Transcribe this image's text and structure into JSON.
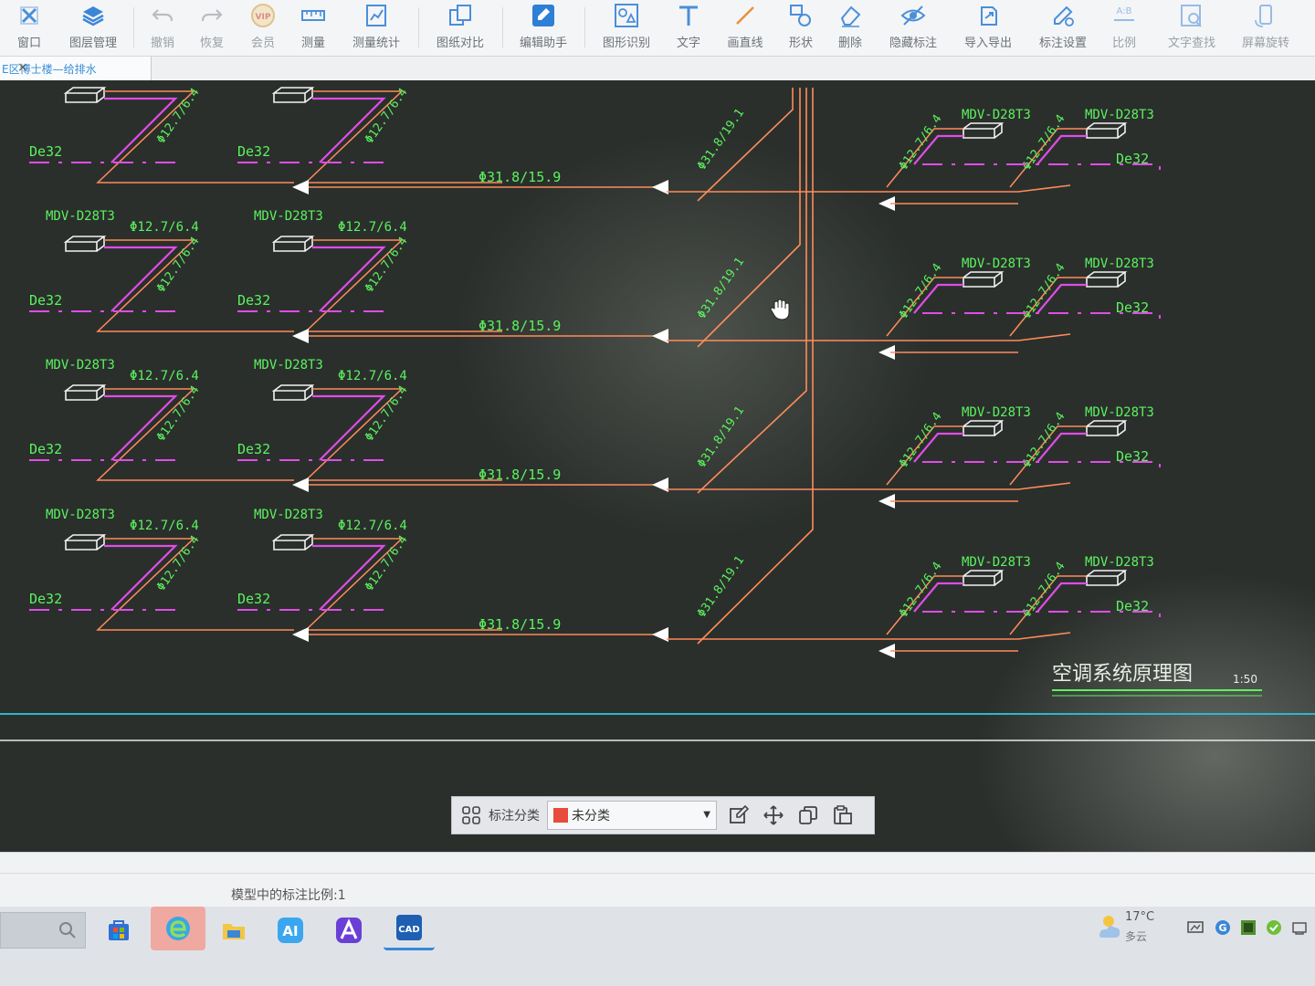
{
  "toolbar": {
    "items": [
      {
        "label": "窗口",
        "icon": "window-icon"
      },
      {
        "label": "图层管理",
        "icon": "layers-icon"
      },
      {
        "label": "撤销",
        "icon": "undo-icon"
      },
      {
        "label": "恢复",
        "icon": "redo-icon"
      },
      {
        "label": "会员",
        "icon": "vip-icon"
      },
      {
        "label": "测量",
        "icon": "ruler-icon"
      },
      {
        "label": "测量统计",
        "icon": "measure-stats-icon"
      },
      {
        "label": "图纸对比",
        "icon": "compare-icon"
      },
      {
        "label": "编辑助手",
        "icon": "edit-assistant-icon"
      },
      {
        "label": "图形识别",
        "icon": "shape-recognition-icon"
      },
      {
        "label": "文字",
        "icon": "text-icon"
      },
      {
        "label": "画直线",
        "icon": "line-icon"
      },
      {
        "label": "形状",
        "icon": "shape-icon"
      },
      {
        "label": "删除",
        "icon": "eraser-icon"
      },
      {
        "label": "隐藏标注",
        "icon": "hide-annotation-icon"
      },
      {
        "label": "导入导出",
        "icon": "import-export-icon"
      },
      {
        "label": "标注设置",
        "icon": "annotation-settings-icon"
      },
      {
        "label": "比例",
        "icon": "scale-icon"
      },
      {
        "label": "文字查找",
        "icon": "text-search-icon"
      },
      {
        "label": "屏幕旋转",
        "icon": "screen-rotate-icon"
      }
    ]
  },
  "tab": {
    "title": "E区博士楼—给排水",
    "close": "×"
  },
  "drawing": {
    "title": "空调系统原理图",
    "scale": "1:50",
    "unit_label": "MDV-D28T3",
    "drain_label": "De32",
    "branch_label": "Φ12.7/6.4",
    "main_label": "Φ31.8/15.9",
    "riser_label": "Φ31.8/19.1",
    "colors": {
      "pipe": "#ff8c5a",
      "drain": "#e04de6",
      "text": "#5cf25e",
      "unit": "#f2f2f2",
      "background": "#2a2f2c"
    }
  },
  "annotation_bar": {
    "label": "标注分类",
    "selected": "未分类",
    "swatch": "#e74c3c"
  },
  "status": {
    "text": "模型中的标注比例:1"
  },
  "taskbar": {
    "temperature": "17°C",
    "condition": "多云",
    "apps": [
      "store-icon",
      "edge-icon",
      "explorer-icon",
      "ai-app-icon",
      "autodesk-icon",
      "cad-viewer-icon"
    ]
  }
}
